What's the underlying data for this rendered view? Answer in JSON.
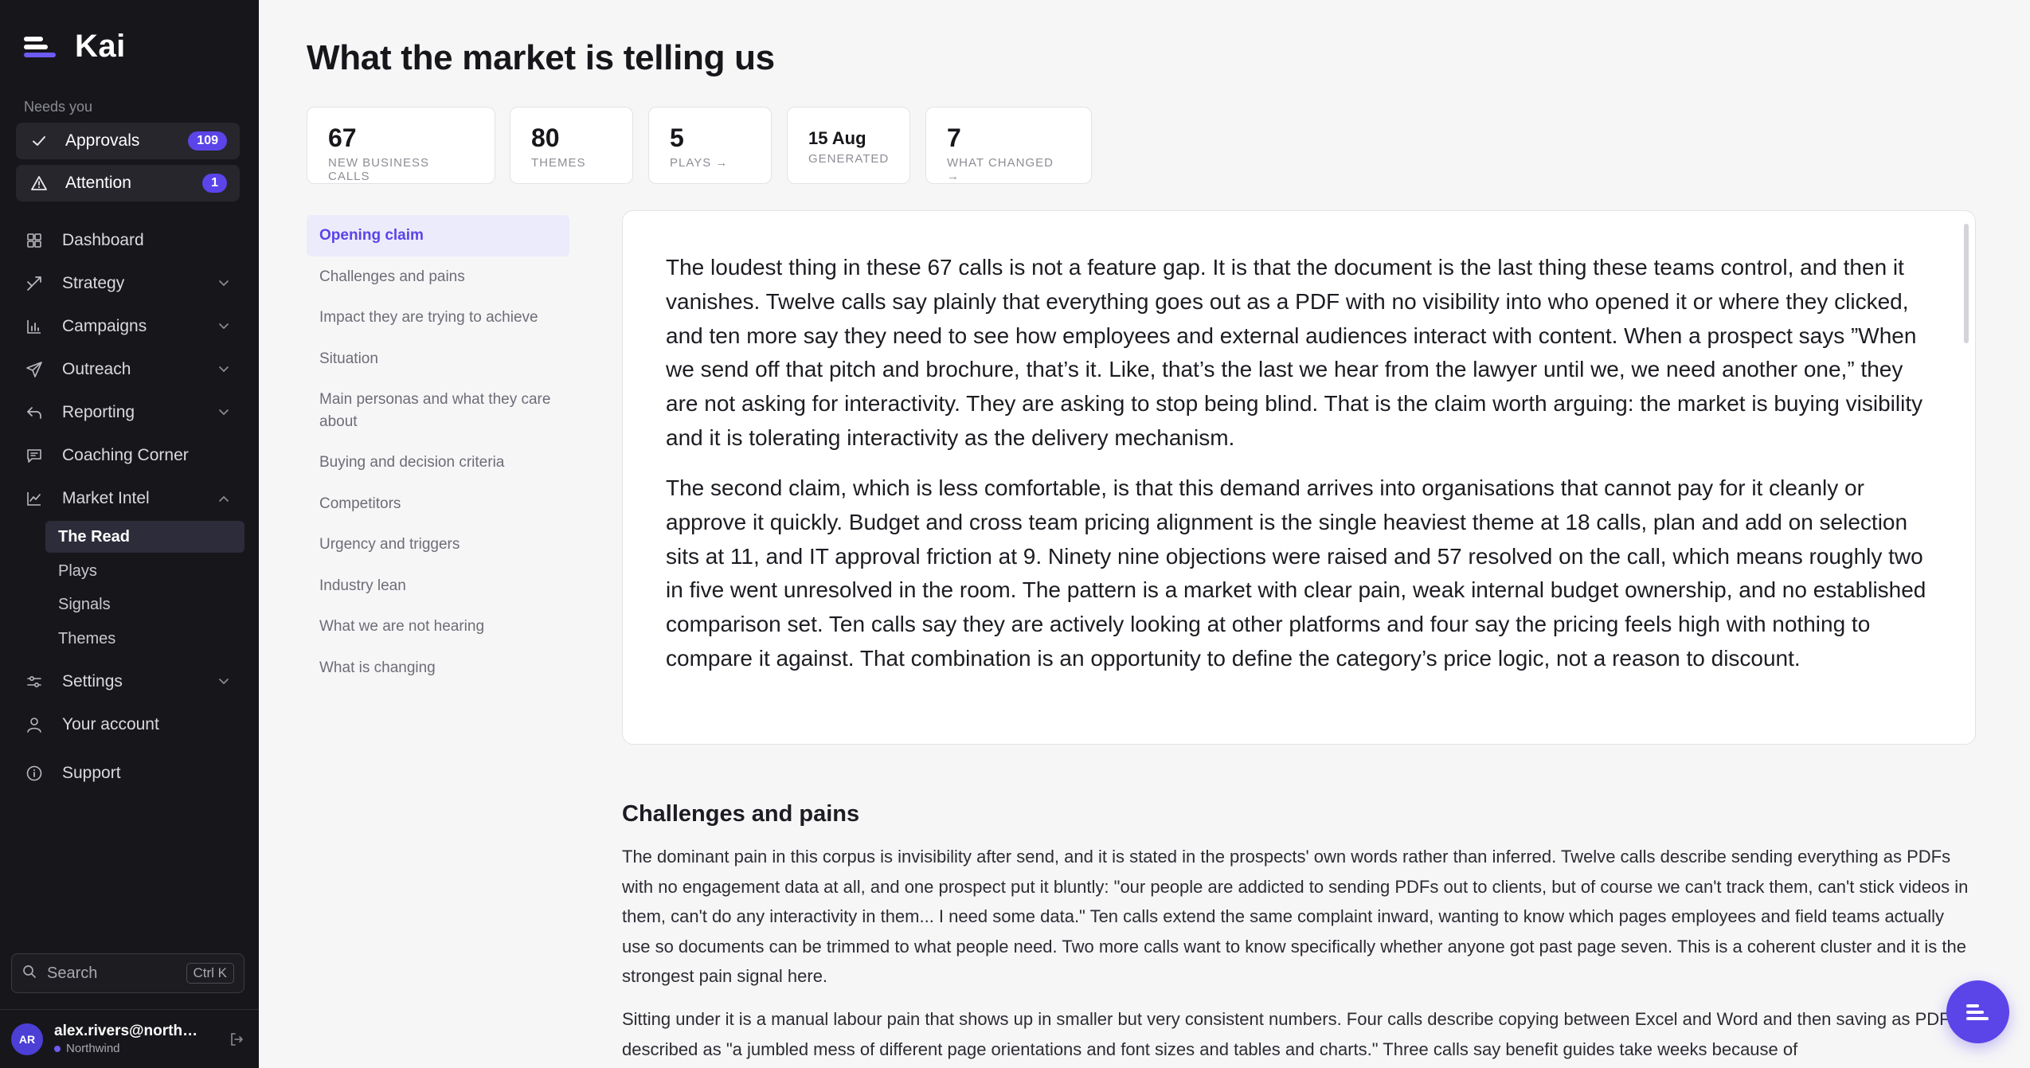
{
  "app": {
    "name": "Kai"
  },
  "sidebar": {
    "section_label": "Needs you",
    "approvals": {
      "label": "Approvals",
      "count": "109"
    },
    "attention": {
      "label": "Attention",
      "count": "1"
    },
    "nav": [
      {
        "label": "Dashboard"
      },
      {
        "label": "Strategy"
      },
      {
        "label": "Campaigns"
      },
      {
        "label": "Outreach"
      },
      {
        "label": "Reporting"
      },
      {
        "label": "Coaching Corner"
      },
      {
        "label": "Market Intel"
      },
      {
        "label": "Settings"
      },
      {
        "label": "Your account"
      },
      {
        "label": "Support"
      }
    ],
    "market_intel_sub": [
      {
        "label": "The Read"
      },
      {
        "label": "Plays"
      },
      {
        "label": "Signals"
      },
      {
        "label": "Themes"
      }
    ],
    "search": {
      "label": "Search",
      "shortcut": "Ctrl K"
    },
    "user": {
      "initials": "AR",
      "email": "alex.rivers@northw...",
      "org": "Northwind"
    }
  },
  "page": {
    "title": "What the market is telling us",
    "stats": [
      {
        "value": "67",
        "caption": "NEW BUSINESS CALLS"
      },
      {
        "value": "80",
        "caption": "THEMES"
      },
      {
        "value": "5",
        "caption": "PLAYS →"
      },
      {
        "value": "15 Aug",
        "caption": "GENERATED"
      },
      {
        "value": "7",
        "caption": "WHAT CHANGED →"
      }
    ],
    "toc": [
      "Opening claim",
      "Challenges and pains",
      "Impact they are trying to achieve",
      "Situation",
      "Main personas and what they care about",
      "Buying and decision criteria",
      "Competitors",
      "Urgency and triggers",
      "Industry lean",
      "What we are not hearing",
      "What is changing"
    ],
    "opening_claim": [
      "The loudest thing in these 67 calls is not a feature gap. It is that the document is the last thing these teams control, and then it vanishes. Twelve calls say plainly that everything goes out as a PDF with no visibility into who opened it or where they clicked, and ten more say they need to see how employees and external audiences interact with content. When a prospect says ”When we send off that pitch and brochure, that’s it. Like, that’s the last we hear from the lawyer until we, we need another one,” they are not asking for interactivity. They are asking to stop being blind. That is the claim worth arguing: the market is buying visibility and it is tolerating interactivity as the delivery mechanism.",
      "The second claim, which is less comfortable, is that this demand arrives into organisations that cannot pay for it cleanly or approve it quickly. Budget and cross team pricing alignment is the single heaviest theme at 18 calls, plan and add on selection sits at 11, and IT approval friction at 9. Ninety nine objections were raised and 57 resolved on the call, which means roughly two in five went unresolved in the room. The pattern is a market with clear pain, weak internal budget ownership, and no established comparison set. Ten calls say they are actively looking at other platforms and four say the pricing feels high with nothing to compare it against. That combination is an opportunity to define the category’s price logic, not a reason to discount."
    ],
    "challenges": {
      "heading": "Challenges and pains",
      "paragraphs": [
        "The dominant pain in this corpus is invisibility after send, and it is stated in the prospects' own words rather than inferred. Twelve calls describe sending everything as PDFs with no engagement data at all, and one prospect put it bluntly: \"our people are addicted to sending PDFs out to clients, but of course we can't track them, can't stick videos in them, can't do any interactivity in them... I need some data.\" Ten calls extend the same complaint inward, wanting to know which pages employees and field teams actually use so documents can be trimmed to what people need. Two more calls want to know specifically whether anyone got past page seven. This is a coherent cluster and it is the strongest pain signal here.",
        "Sitting under it is a manual labour pain that shows up in smaller but very consistent numbers. Four calls describe copying between Excel and Word and then saving as PDF, described as \"a jumbled mess of different page orientations and font sizes and tables and charts.\" Three calls say benefit guides take weeks because of"
      ]
    }
  },
  "colors": {
    "accent": "#5b44e8",
    "sidebar_bg": "#17171b"
  }
}
